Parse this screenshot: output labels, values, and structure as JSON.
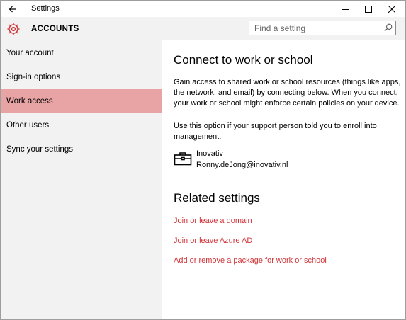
{
  "window": {
    "title": "Settings"
  },
  "header": {
    "title": "ACCOUNTS",
    "search_placeholder": "Find a setting"
  },
  "sidebar": {
    "items": [
      {
        "label": "Your account"
      },
      {
        "label": "Sign-in options"
      },
      {
        "label": "Work access",
        "selected": true
      },
      {
        "label": "Other users"
      },
      {
        "label": "Sync your settings"
      }
    ]
  },
  "main": {
    "heading": "Connect to work or school",
    "description1": "Gain access to shared work or school resources (things like apps, the network, and email) by connecting below. When you connect, your work or school might enforce certain policies on your device.",
    "description2": "Use this option if your support person told you to enroll into management.",
    "account": {
      "name": "Inovativ",
      "email": "Ronny.deJong@inovativ.nl",
      "icon": "briefcase-icon"
    },
    "related_heading": "Related settings",
    "links": [
      {
        "label": "Join or leave a domain"
      },
      {
        "label": "Join or leave Azure AD"
      },
      {
        "label": "Add or remove a package for work or school"
      }
    ]
  },
  "colors": {
    "accent": "#d13438",
    "selected_bg": "#e8a4a4",
    "sidebar_bg": "#f2f2f2"
  }
}
